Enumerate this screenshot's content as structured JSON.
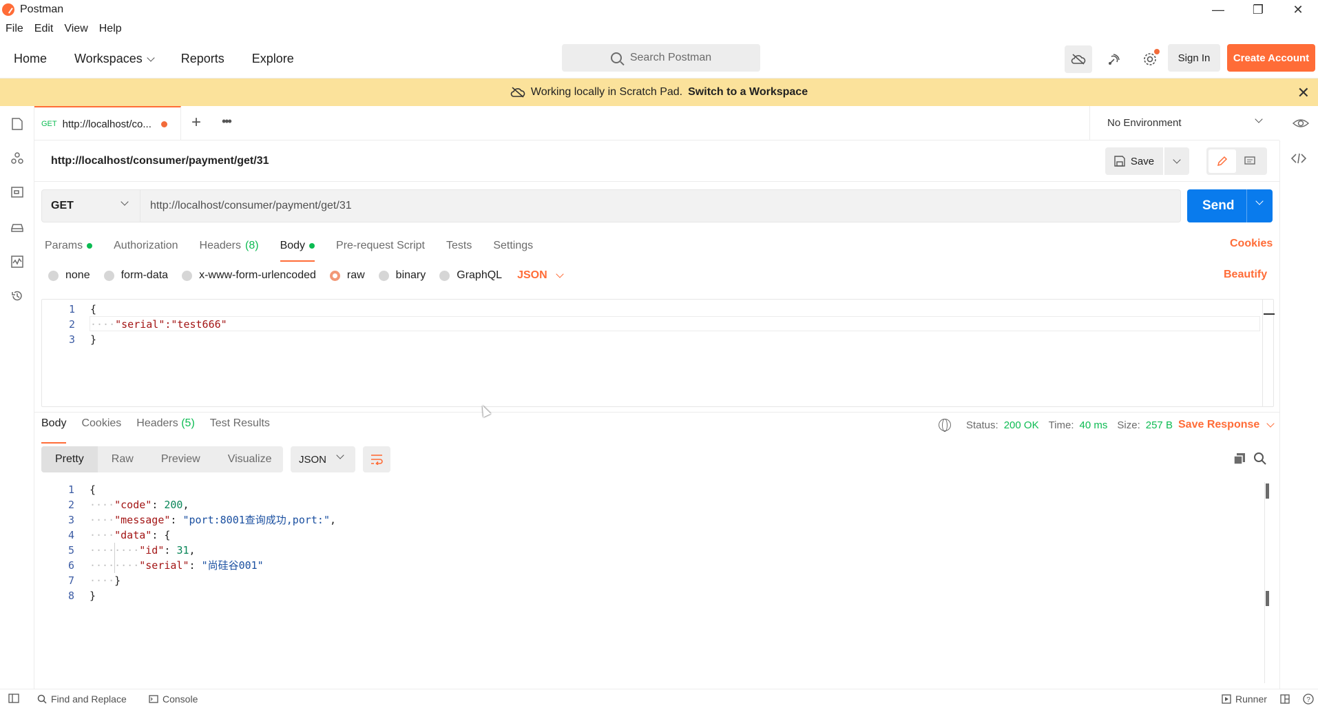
{
  "window": {
    "title": "Postman",
    "controls": [
      "minimize",
      "restore",
      "close"
    ]
  },
  "menu": [
    "File",
    "Edit",
    "View",
    "Help"
  ],
  "header": {
    "nav": [
      "Home",
      "Workspaces",
      "Reports",
      "Explore"
    ],
    "search_placeholder": "Search Postman",
    "sign_in": "Sign In",
    "create_account": "Create Account"
  },
  "banner": {
    "text": "Working locally in Scratch Pad.",
    "link": "Switch to a Workspace"
  },
  "tab": {
    "method": "GET",
    "name": "http://localhost/co...",
    "unsaved": true
  },
  "environment": "No Environment",
  "request": {
    "title": "http://localhost/consumer/payment/get/31",
    "save_label": "Save",
    "method": "GET",
    "url": "http://localhost/consumer/payment/get/31",
    "send_label": "Send",
    "tabs": [
      {
        "label": "Params",
        "dot": true
      },
      {
        "label": "Authorization"
      },
      {
        "label": "Headers",
        "count": "(8)"
      },
      {
        "label": "Body",
        "dot": true,
        "active": true
      },
      {
        "label": "Pre-request Script"
      },
      {
        "label": "Tests"
      },
      {
        "label": "Settings"
      }
    ],
    "cookies_label": "Cookies",
    "body_types": [
      "none",
      "form-data",
      "x-www-form-urlencoded",
      "raw",
      "binary",
      "GraphQL"
    ],
    "body_type_selected": "raw",
    "raw_format": "JSON",
    "beautify_label": "Beautify",
    "body_lines": [
      "{",
      "\"serial\":\"test666\"",
      "}"
    ]
  },
  "response": {
    "tabs": [
      "Body",
      "Cookies",
      "Headers",
      "Test Results"
    ],
    "headers_count": "(5)",
    "status_label": "Status:",
    "status_value": "200 OK",
    "time_label": "Time:",
    "time_value": "40 ms",
    "size_label": "Size:",
    "size_value": "257 B",
    "save_response": "Save Response",
    "views": [
      "Pretty",
      "Raw",
      "Preview",
      "Visualize"
    ],
    "format": "JSON",
    "body": {
      "code_key": "\"code\"",
      "code_val": "200",
      "message_key": "\"message\"",
      "message_val": "\"port:8001查询成功,port:\"",
      "data_key": "\"data\"",
      "id_key": "\"id\"",
      "id_val": "31",
      "serial_key": "\"serial\"",
      "serial_val": "\"尚硅谷001\""
    },
    "line_numbers": [
      "1",
      "2",
      "3",
      "4",
      "5",
      "6",
      "7",
      "8"
    ]
  },
  "statusbar": {
    "find_replace": "Find and Replace",
    "console": "Console",
    "runner": "Runner"
  }
}
